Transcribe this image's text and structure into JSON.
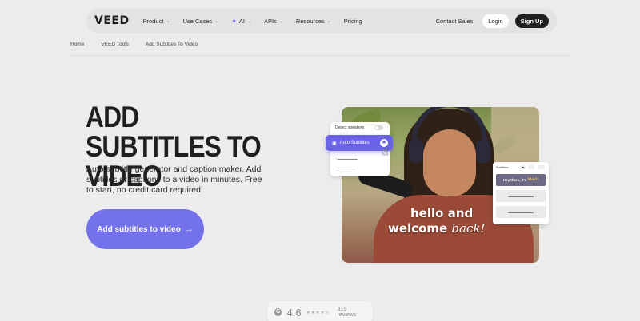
{
  "nav": {
    "logo": "VEED",
    "items": [
      {
        "label": "Product",
        "chevron": true
      },
      {
        "label": "Use Cases",
        "chevron": true
      },
      {
        "label": "AI",
        "chevron": true,
        "icon": "sparkle-icon"
      },
      {
        "label": "APIs",
        "chevron": true
      },
      {
        "label": "Resources",
        "chevron": true
      },
      {
        "label": "Pricing",
        "chevron": false
      }
    ],
    "contact": "Contact Sales",
    "login": "Login",
    "signup": "Sign Up"
  },
  "breadcrumb": [
    "Home",
    "VEED Tools",
    "Add Subtitles To Video"
  ],
  "hero": {
    "title_line1": "ADD SUBTITLES TO",
    "title_line2": "VIDEO",
    "description": "Auto subtitle generator and caption maker. Add subtitles or captions to a video in minutes. Free to start, no credit card required",
    "cta": "Add subtitles to video",
    "cta_arrow": "→"
  },
  "editor_mock": {
    "detect_speakers": "Detect speakers",
    "auto_subtitles": "Auto Subtitles",
    "caption_line1": "hello and",
    "caption_line2": "welcome",
    "caption_emphasis": "back!",
    "subtitles_panel": {
      "title": "Subtitles",
      "row1_prefix": "Hey there, it's",
      "row1_highlight": "Mari!"
    }
  },
  "rating": {
    "score": "4.6",
    "stars": "★★★★½",
    "reviews": "319 reviews"
  },
  "colors": {
    "accent": "#7472ea",
    "background": "#ececec",
    "dark": "#1f1f1f"
  }
}
